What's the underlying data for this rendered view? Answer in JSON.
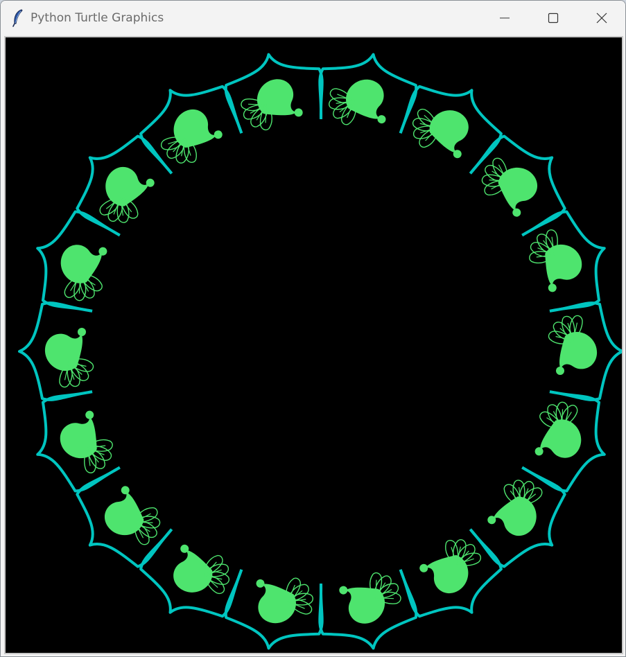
{
  "window": {
    "title": "Python Turtle Graphics",
    "controls": {
      "minimize": "minimize",
      "maximize": "maximize",
      "close": "close"
    }
  },
  "canvas": {
    "background": "#000000",
    "pattern": {
      "petal_count": 18,
      "petal_outline_color": "#00c5c0",
      "paisley_fill_color": "#4ee46e",
      "fan_outline_color": "#4ee46e",
      "fan_lobes": 4
    }
  }
}
